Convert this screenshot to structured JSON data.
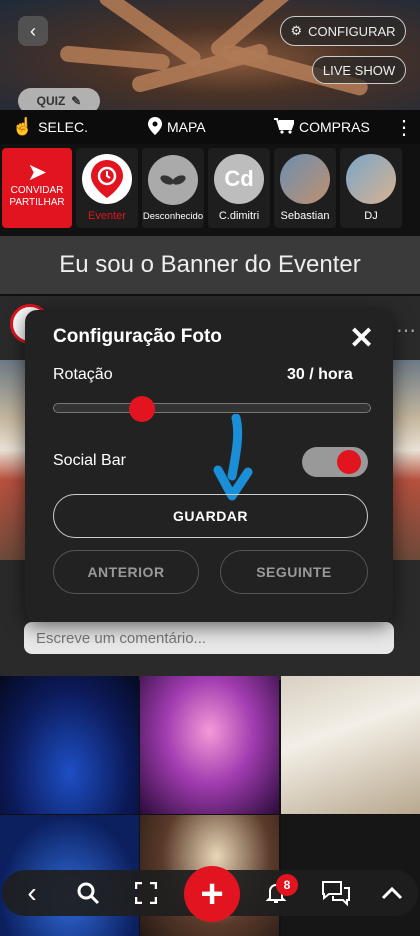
{
  "hero": {
    "configure_label": "CONFIGURAR",
    "live_show_label": "LIVE SHOW",
    "quiz_label": "QUIZ"
  },
  "menubar": {
    "select_label": "SELEC.",
    "map_label": "MAPA",
    "shop_label": "COMPRAS"
  },
  "contacts": {
    "invite_label_line1": "CONVIDAR",
    "invite_label_line2": "PARTILHAR",
    "items": [
      {
        "name": "Eventer",
        "initials": ""
      },
      {
        "name": "Desconhecido",
        "initials": ""
      },
      {
        "name": "C.dimitri",
        "initials": "Cd"
      },
      {
        "name": "Sebastian",
        "initials": ""
      },
      {
        "name": "DJ",
        "initials": ""
      }
    ]
  },
  "banner": {
    "text": "Eu sou o Banner do Eventer"
  },
  "comment": {
    "placeholder": "Escreve um comentário..."
  },
  "dialog": {
    "title": "Configuração Foto",
    "rotation_label": "Rotação",
    "rotation_value": "30 / hora",
    "slider_level": 0.29,
    "social_bar_label": "Social Bar",
    "social_bar_on": true,
    "save_label": "GUARDAR",
    "previous_label": "ANTERIOR",
    "next_label": "SEGUINTE"
  },
  "bottomnav": {
    "notifications_count": "8"
  },
  "colors": {
    "accent": "#e1141f",
    "dialog_bg": "#222222",
    "arrow": "#1a8fd8"
  }
}
